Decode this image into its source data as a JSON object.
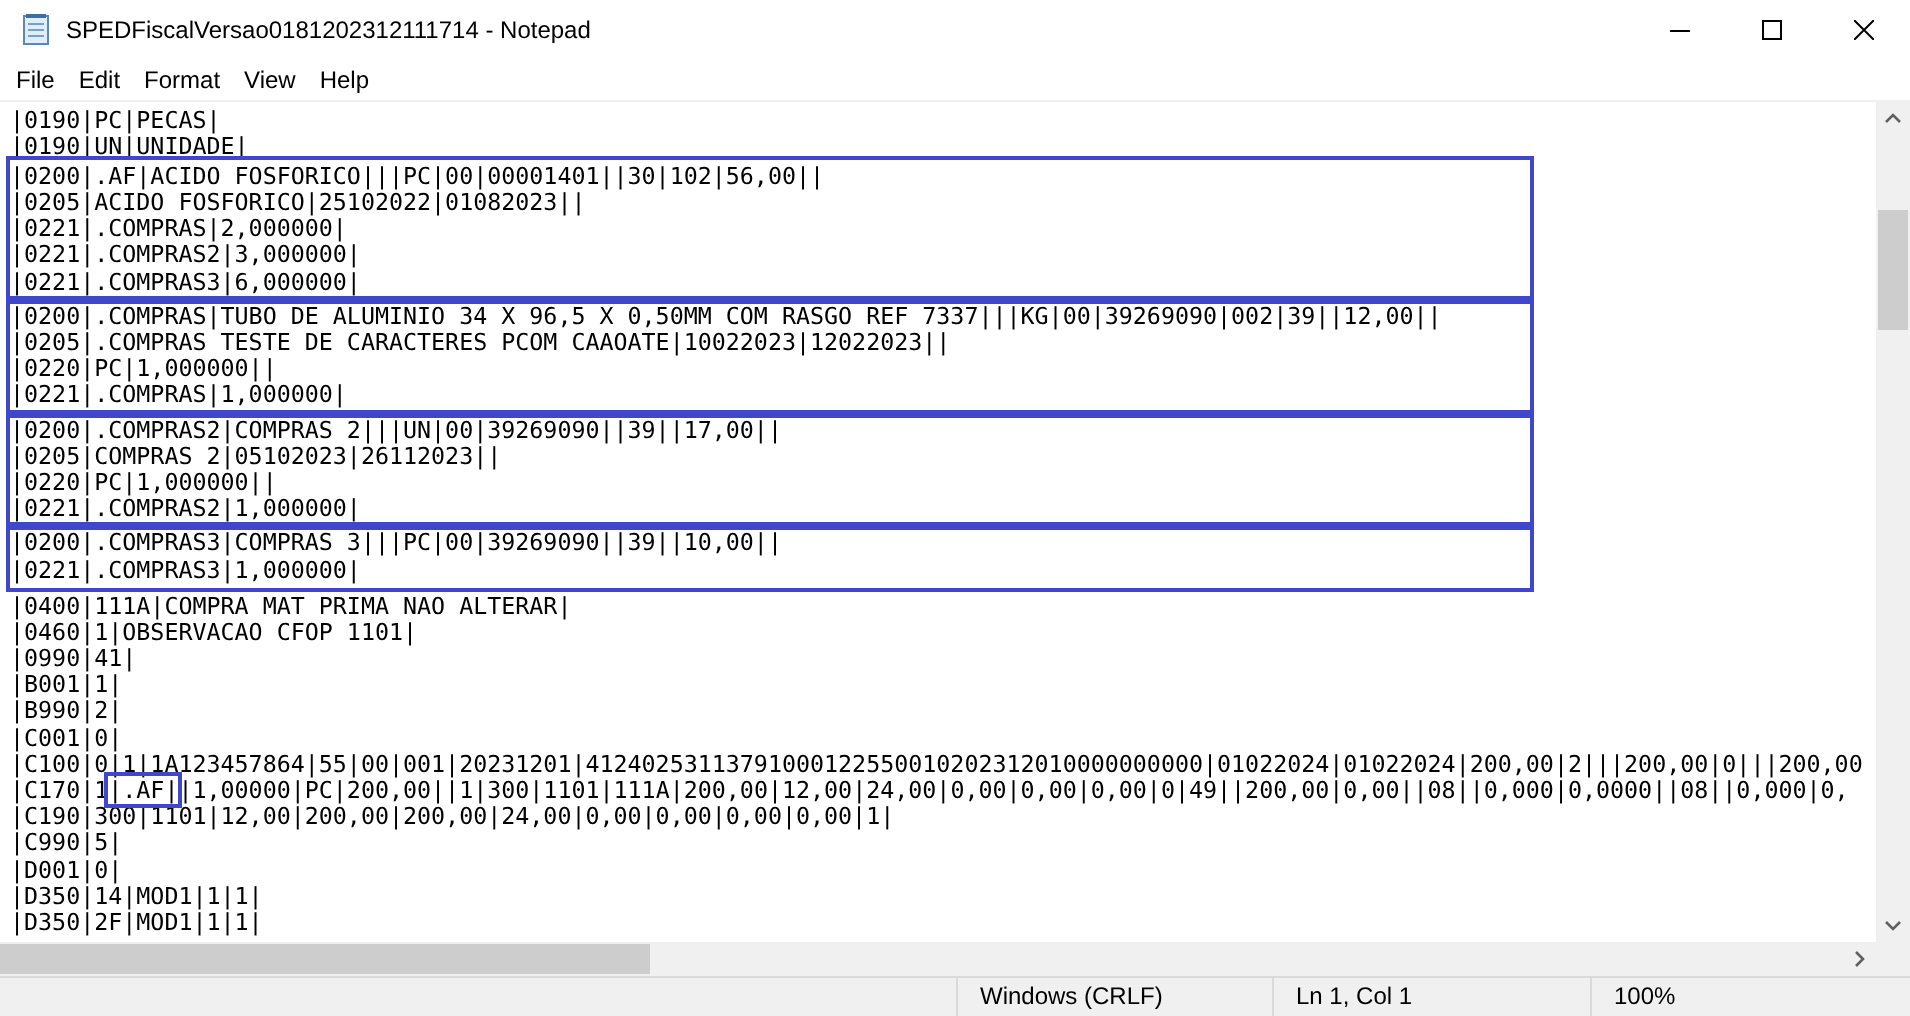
{
  "window": {
    "title": "SPEDFiscalVersao0181202312111714 - Notepad"
  },
  "menu": [
    "File",
    "Edit",
    "Format",
    "View",
    "Help"
  ],
  "blocks": [
    {
      "highlighted": false,
      "lines": [
        "|0190|PC|PECAS|",
        "|0190|UN|UNIDADE|"
      ]
    },
    {
      "highlighted": true,
      "lines": [
        "|0200|.AF|ACIDO FOSFORICO|||PC|00|00001401||30|102|56,00||",
        "|0205|ACIDO FOSFORICO|25102022|01082023||",
        "|0221|.COMPRAS|2,000000|",
        "|0221|.COMPRAS2|3,000000|",
        "|0221|.COMPRAS3|6,000000|"
      ]
    },
    {
      "highlighted": true,
      "lines": [
        "|0200|.COMPRAS|TUBO DE ALUMINIO 34 X 96,5 X 0,50MM COM RASGO REF 7337|||KG|00|39269090|002|39||12,00||",
        "|0205|.COMPRAS TESTE DE CARACTERES PCOM CAAOATE|10022023|12022023||",
        "|0220|PC|1,000000||",
        "|0221|.COMPRAS|1,000000|"
      ]
    },
    {
      "highlighted": true,
      "lines": [
        "|0200|.COMPRAS2|COMPRAS 2|||UN|00|39269090||39||17,00||",
        "|0205|COMPRAS 2|05102023|26112023||",
        "|0220|PC|1,000000||",
        "|0221|.COMPRAS2|1,000000|"
      ]
    },
    {
      "highlighted": true,
      "lines": [
        "|0200|.COMPRAS3|COMPRAS 3|||PC|00|39269090||39||10,00||",
        "|0221|.COMPRAS3|1,000000|"
      ]
    },
    {
      "highlighted": false,
      "lines": [
        "|0400|111A|COMPRA MAT PRIMA NAO ALTERAR|",
        "|0460|1|OBSERVACAO CFOP 1101|",
        "|0990|41|",
        "|B001|1|",
        "|B990|2|",
        "|C001|0|",
        "|C100|0|1|1A123457864|55|00|001|20231201|41240253113791000122550010202312010000000000|01022024|01022024|200,00|2|||200,00|0|||200,00",
        {
          "kind": "segmented",
          "segments": [
            {
              "text": "|C170|1",
              "highlighted": false
            },
            {
              "text": "|.AF|",
              "highlighted": true
            },
            {
              "text": "|1,00000|PC|200,00||1|300|1101|111A|200,00|12,00|24,00|0,00|0,00|0,00|0|49||200,00|0,00||08||0,000|0,0000||08||0,000|0,",
              "highlighted": false
            }
          ]
        },
        "|C190|300|1101|12,00|200,00|200,00|24,00|0,00|0,00|0,00|0,00|1|",
        "|C990|5|",
        "|D001|0|",
        "|D350|14|MOD1|1|1|",
        "|D350|2F|MOD1|1|1|"
      ]
    }
  ],
  "status_bar": {
    "line_ending": "Windows (CRLF)",
    "position": "Ln 1, Col 1",
    "zoom": "100%"
  }
}
